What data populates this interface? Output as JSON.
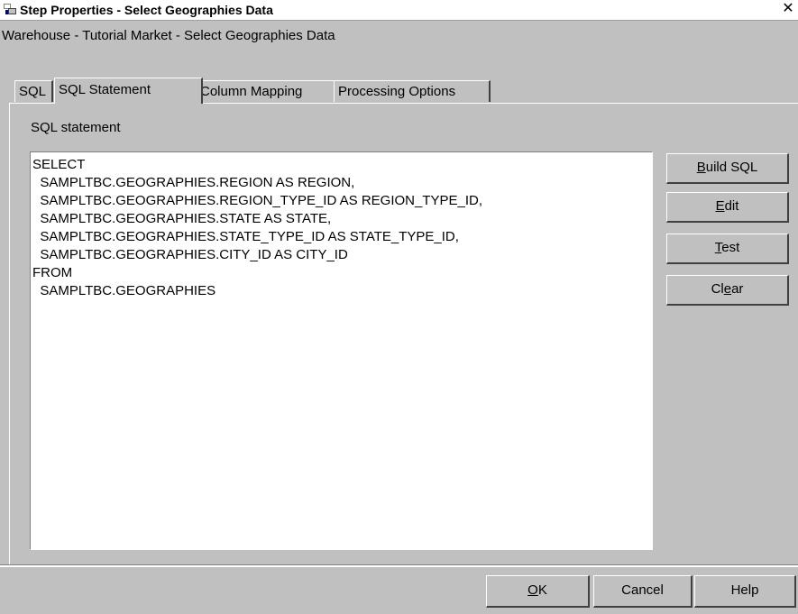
{
  "window": {
    "title": "Step Properties - Select Geographies Data",
    "close_glyph": "✕",
    "icon": "step-properties-icon"
  },
  "subtitle": "Warehouse - Tutorial Market - Select Geographies Data",
  "tabs": [
    {
      "label": "SQL",
      "active": false
    },
    {
      "label": "SQL Statement",
      "active": true
    },
    {
      "label": "Column Mapping",
      "active": false
    },
    {
      "label": "Processing Options",
      "active": false
    }
  ],
  "panel": {
    "label": "SQL statement",
    "sql_lines": [
      "SELECT",
      "  SAMPLTBC.GEOGRAPHIES.REGION AS REGION,",
      "  SAMPLTBC.GEOGRAPHIES.REGION_TYPE_ID AS REGION_TYPE_ID,",
      "  SAMPLTBC.GEOGRAPHIES.STATE AS STATE,",
      "  SAMPLTBC.GEOGRAPHIES.STATE_TYPE_ID AS STATE_TYPE_ID,",
      "  SAMPLTBC.GEOGRAPHIES.CITY_ID AS CITY_ID",
      "FROM",
      "  SAMPLTBC.GEOGRAPHIES"
    ]
  },
  "side_buttons": {
    "build_sql": {
      "mnemonic": "B",
      "rest": "uild SQL"
    },
    "edit": {
      "mnemonic": "E",
      "rest": "dit"
    },
    "test": {
      "mnemonic": "T",
      "rest": "est"
    },
    "clear": {
      "pre": "Cl",
      "mnemonic": "e",
      "rest": "ar"
    }
  },
  "bottom_buttons": {
    "ok": {
      "mnemonic": "O",
      "rest": "K"
    },
    "cancel": "Cancel",
    "help": "Help"
  },
  "colors": {
    "background": "#c0c0c0",
    "text_area": "#ffffff",
    "shadow": "#404040",
    "highlight": "#ffffff"
  }
}
